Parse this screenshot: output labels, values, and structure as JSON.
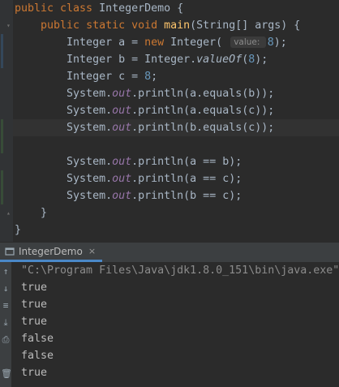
{
  "editor": {
    "lines": [
      {
        "parts": [
          [
            "kw",
            "public class "
          ],
          [
            "txt",
            "IntegerDemo {"
          ]
        ]
      },
      {
        "parts": [
          [
            "txt",
            "    "
          ],
          [
            "kw",
            "public static void "
          ],
          [
            "fn",
            "main"
          ],
          [
            "txt",
            "(String[] args) {"
          ]
        ]
      },
      {
        "parts": [
          [
            "txt",
            "        Integer a = "
          ],
          [
            "kw",
            "new "
          ],
          [
            "txt",
            "Integer( "
          ],
          [
            "hint",
            "value: "
          ],
          [
            "num",
            "8"
          ],
          [
            "txt",
            ");"
          ]
        ]
      },
      {
        "parts": [
          [
            "txt",
            "        Integer b = Integer."
          ],
          [
            "statm",
            "valueOf"
          ],
          [
            "txt",
            "("
          ],
          [
            "num",
            "8"
          ],
          [
            "txt",
            ");"
          ]
        ]
      },
      {
        "parts": [
          [
            "txt",
            "        Integer c = "
          ],
          [
            "num",
            "8"
          ],
          [
            "txt",
            ";"
          ]
        ]
      },
      {
        "parts": [
          [
            "txt",
            "        System."
          ],
          [
            "stat",
            "out"
          ],
          [
            "txt",
            ".println(a.equals(b));"
          ]
        ]
      },
      {
        "parts": [
          [
            "txt",
            "        System."
          ],
          [
            "stat",
            "out"
          ],
          [
            "txt",
            ".println(a.equals(c));"
          ]
        ]
      },
      {
        "parts": [
          [
            "txt",
            "        System."
          ],
          [
            "stat",
            "out"
          ],
          [
            "txt",
            ".println(b.equals(c));"
          ]
        ]
      },
      {
        "parts": [
          [
            "txt",
            ""
          ]
        ]
      },
      {
        "parts": [
          [
            "txt",
            "        System."
          ],
          [
            "stat",
            "out"
          ],
          [
            "txt",
            ".println(a == b);"
          ]
        ]
      },
      {
        "parts": [
          [
            "txt",
            "        System."
          ],
          [
            "stat",
            "out"
          ],
          [
            "txt",
            ".println(a == c);"
          ]
        ]
      },
      {
        "parts": [
          [
            "txt",
            "        System."
          ],
          [
            "stat",
            "out"
          ],
          [
            "txt",
            ".println(b == c);"
          ]
        ]
      },
      {
        "parts": [
          [
            "txt",
            "    }"
          ]
        ]
      },
      {
        "parts": [
          [
            "txt",
            "}"
          ]
        ]
      }
    ]
  },
  "run_panel": {
    "tab_label": "IntegerDemo",
    "close_symbol": "×"
  },
  "console": {
    "command": "\"C:\\Program Files\\Java\\jdk1.8.0_151\\bin\\java.exe\"",
    "output": [
      "true",
      "true",
      "true",
      "false",
      "false",
      "true"
    ]
  },
  "icons": {
    "tab_icon": "run-config-icon",
    "side": [
      "arrow-up-icon",
      "arrow-down-icon",
      "soft-wrap-icon",
      "scroll-to-end-icon",
      "print-icon",
      "delete-icon"
    ]
  }
}
